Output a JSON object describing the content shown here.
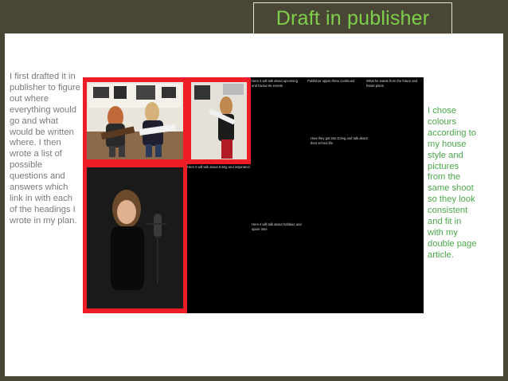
{
  "title": "Draft in publisher",
  "left_text": "I first drafted it in publisher to figure out where everything would go and what would be written where. I then wrote a list of possible questions and answers which link in with each of the headings I wrote in my plan.",
  "right_text": "I chose colours according to my house style and pictures from the same shoot so they look consistent and fit in with my double page article.",
  "spread": {
    "notes": [
      "Here it will talk about upcoming and favour-ite events",
      "Publisher upper three continued",
      "What he wants from the future and future plans",
      "How they got into DJing and talk about their school life",
      "Here it will talk about DJing and inspiration",
      "Here it will talk about hobbies and spare time"
    ]
  },
  "colors": {
    "title_green": "#7ed04a",
    "body_green": "#4aa84a",
    "frame_dark": "#4a4636",
    "photo_border_red": "#ee1c24"
  }
}
